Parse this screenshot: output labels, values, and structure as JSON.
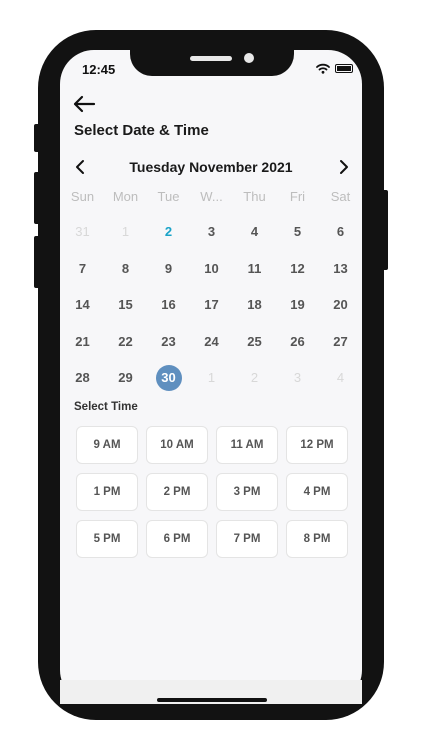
{
  "status_bar": {
    "time": "12:45",
    "icons": [
      "wifi-icon",
      "battery-icon"
    ]
  },
  "header": {
    "back_icon": "arrow-left-icon",
    "title": "Select Date & Time"
  },
  "calendar": {
    "month_label": "Tuesday November 2021",
    "prev_icon": "chevron-left-icon",
    "next_icon": "chevron-right-icon",
    "weekdays": [
      "Sun",
      "Mon",
      "Tue",
      "W...",
      "Thu",
      "Fri",
      "Sat"
    ],
    "weeks": [
      [
        "31",
        "1",
        "2",
        "3",
        "4",
        "5",
        "6"
      ],
      [
        "7",
        "8",
        "9",
        "10",
        "11",
        "12",
        "13"
      ],
      [
        "14",
        "15",
        "16",
        "17",
        "18",
        "19",
        "20"
      ],
      [
        "21",
        "22",
        "23",
        "24",
        "25",
        "26",
        "27"
      ],
      [
        "28",
        "29",
        "30",
        "1",
        "2",
        "3",
        "4"
      ]
    ],
    "today": "2",
    "selected": "30",
    "colors": {
      "today": "#1aa3c8",
      "selected_bg": "#5f8fbf"
    }
  },
  "time_section": {
    "label": "Select Time",
    "slots": [
      [
        "9 AM",
        "10 AM",
        "11 AM",
        "12 PM"
      ],
      [
        "1 PM",
        "2 PM",
        "3 PM",
        "4 PM"
      ],
      [
        "5 PM",
        "6 PM",
        "7 PM",
        "8 PM"
      ]
    ]
  }
}
